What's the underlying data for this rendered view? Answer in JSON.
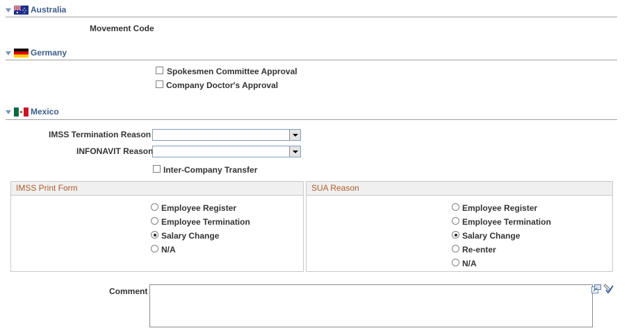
{
  "sections": {
    "australia": {
      "title": "Australia",
      "movement_code_label": "Movement Code"
    },
    "germany": {
      "title": "Germany",
      "checkboxes": [
        {
          "label": "Spokesmen Committee Approval",
          "checked": false
        },
        {
          "label": "Company Doctor's Approval",
          "checked": false
        }
      ]
    },
    "mexico": {
      "title": "Mexico",
      "imss_termination_label": "IMSS Termination Reason",
      "imss_termination_value": "",
      "infonavit_label": "INFONAVIT Reason",
      "infonavit_value": "",
      "intercompany_label": "Inter-Company Transfer",
      "intercompany_checked": false,
      "imss_print_form": {
        "title": "IMSS Print Form",
        "options": [
          "Employee Register",
          "Employee Termination",
          "Salary Change",
          "N/A"
        ],
        "selected": "Salary Change"
      },
      "sua_reason": {
        "title": "SUA Reason",
        "options": [
          "Employee Register",
          "Employee Termination",
          "Salary Change",
          "Re-enter",
          "N/A"
        ],
        "selected": "Salary Change"
      },
      "comment_label": "Comment",
      "comment_value": ""
    }
  },
  "colors": {
    "section_title": "#3b5d8a",
    "box_title": "#b05c2c",
    "rule": "#a0a0a0"
  },
  "icons": [
    "collapse-triangle-icon",
    "australia-flag-icon",
    "germany-flag-icon",
    "mexico-flag-icon",
    "expand-textarea-icon",
    "spell-check-icon"
  ]
}
